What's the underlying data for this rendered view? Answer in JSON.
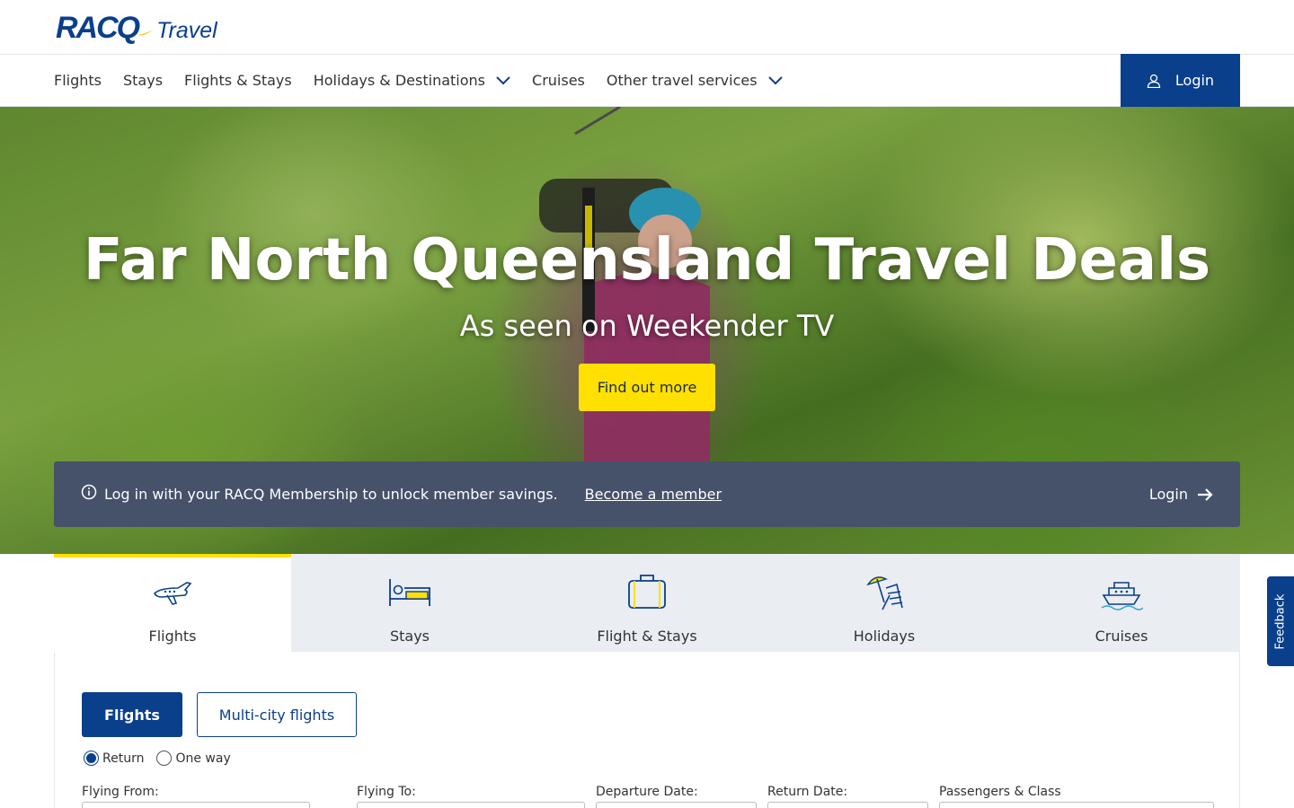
{
  "brand": {
    "racq": "RACQ",
    "travel": "Travel"
  },
  "nav": {
    "items": [
      {
        "label": "Flights",
        "dropdown": false
      },
      {
        "label": "Stays",
        "dropdown": false
      },
      {
        "label": "Flights & Stays",
        "dropdown": false
      },
      {
        "label": "Holidays & Destinations",
        "dropdown": true
      },
      {
        "label": "Cruises",
        "dropdown": false
      },
      {
        "label": "Other travel services",
        "dropdown": true
      }
    ],
    "login_label": "Login"
  },
  "hero": {
    "title": "Far North Queensland Travel Deals",
    "subtitle": "As seen on Weekender TV",
    "cta_label": "Find out more"
  },
  "member_banner": {
    "message": "Log in with your RACQ Membership to unlock member savings.",
    "become_member": "Become a member",
    "login_label": "Login"
  },
  "search": {
    "tabs": [
      {
        "label": "Flights",
        "icon": "plane-icon",
        "active": true
      },
      {
        "label": "Stays",
        "icon": "bed-icon",
        "active": false
      },
      {
        "label": "Flight & Stays",
        "icon": "suitcase-icon",
        "active": false
      },
      {
        "label": "Holidays",
        "icon": "beach-chair-icon",
        "active": false
      },
      {
        "label": "Cruises",
        "icon": "cruise-ship-icon",
        "active": false
      }
    ],
    "modes": {
      "flights": "Flights",
      "multi_city": "Multi-city flights"
    },
    "trip_types": {
      "return": "Return",
      "one_way": "One way",
      "selected": "Return"
    },
    "fields": {
      "from": "Flying From:",
      "to": "Flying To:",
      "departure": "Departure Date:",
      "return_date": "Return Date:",
      "passengers": "Passengers & Class"
    }
  },
  "feedback_label": "Feedback",
  "colors": {
    "brand_navy": "#0a3f8c",
    "accent_yellow": "#ffe000",
    "banner_slate": "#46516a"
  }
}
